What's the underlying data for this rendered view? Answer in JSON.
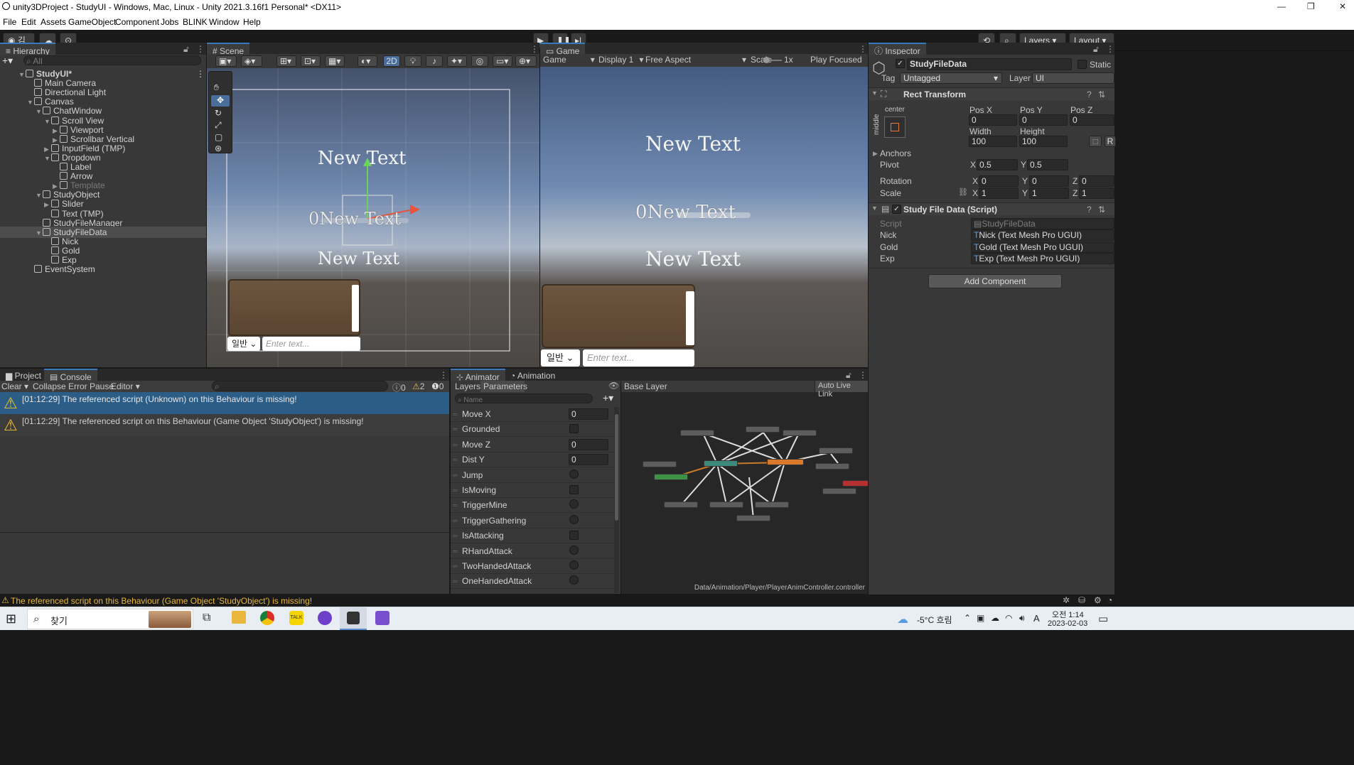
{
  "window": {
    "title": "unity3DProject - StudyUI - Windows, Mac, Linux - Unity 2021.3.16f1 Personal* <DX11>"
  },
  "menu": [
    "File",
    "Edit",
    "Assets",
    "GameObject",
    "Component",
    "Jobs",
    "BLINK",
    "Window",
    "Help"
  ],
  "toolbar": {
    "account": "김",
    "layers": "Layers",
    "layout": "Layout"
  },
  "hierarchy": {
    "tab": "Hierarchy",
    "search_placeholder": "All",
    "items": [
      {
        "label": "StudyUI*",
        "depth": 0,
        "arrow": "▼",
        "scene": true
      },
      {
        "label": "Main Camera",
        "depth": 1,
        "arrow": ""
      },
      {
        "label": "Directional Light",
        "depth": 1,
        "arrow": ""
      },
      {
        "label": "Canvas",
        "depth": 1,
        "arrow": "▼"
      },
      {
        "label": "ChatWindow",
        "depth": 2,
        "arrow": "▼"
      },
      {
        "label": "Scroll View",
        "depth": 3,
        "arrow": "▼"
      },
      {
        "label": "Viewport",
        "depth": 4,
        "arrow": "▶"
      },
      {
        "label": "Scrollbar Vertical",
        "depth": 4,
        "arrow": "▶"
      },
      {
        "label": "InputField (TMP)",
        "depth": 3,
        "arrow": "▶"
      },
      {
        "label": "Dropdown",
        "depth": 3,
        "arrow": "▼"
      },
      {
        "label": "Label",
        "depth": 4,
        "arrow": ""
      },
      {
        "label": "Arrow",
        "depth": 4,
        "arrow": ""
      },
      {
        "label": "Template",
        "depth": 4,
        "arrow": "▶",
        "dim": true
      },
      {
        "label": "StudyObject",
        "depth": 2,
        "arrow": "▼"
      },
      {
        "label": "Slider",
        "depth": 3,
        "arrow": "▶"
      },
      {
        "label": "Text (TMP)",
        "depth": 3,
        "arrow": ""
      },
      {
        "label": "StudyFileManager",
        "depth": 2,
        "arrow": ""
      },
      {
        "label": "StudyFileData",
        "depth": 2,
        "arrow": "▼",
        "selected": true
      },
      {
        "label": "Nick",
        "depth": 3,
        "arrow": ""
      },
      {
        "label": "Gold",
        "depth": 3,
        "arrow": ""
      },
      {
        "label": "Exp",
        "depth": 3,
        "arrow": ""
      },
      {
        "label": "EventSystem",
        "depth": 1,
        "arrow": ""
      }
    ]
  },
  "scene": {
    "tab": "Scene",
    "mode_2d": "2D",
    "texts": [
      "New Text",
      "0New Text",
      "New Text"
    ],
    "dropdown_value": "일반",
    "input_placeholder": "Enter text..."
  },
  "game": {
    "tab": "Game",
    "mode": "Game",
    "display": "Display 1",
    "aspect": "Free Aspect",
    "scale_label": "Scale",
    "scale_value": "1x",
    "play_focused": "Play Focused",
    "texts": [
      "New Text",
      "0New Text",
      "New Text"
    ],
    "dropdown_value": "일반",
    "input_placeholder": "Enter text..."
  },
  "inspector": {
    "tab": "Inspector",
    "object_name": "StudyFileData",
    "static_label": "Static",
    "tag_label": "Tag",
    "tag_value": "Untagged",
    "layer_label": "Layer",
    "layer_value": "UI",
    "rect_transform": {
      "title": "Rect Transform",
      "anchor_h": "center",
      "anchor_v": "middle",
      "pos_x_label": "Pos X",
      "pos_x": "0",
      "pos_y_label": "Pos Y",
      "pos_y": "0",
      "pos_z_label": "Pos Z",
      "pos_z": "0",
      "width_label": "Width",
      "width": "100",
      "height_label": "Height",
      "height": "100",
      "r_button": "R",
      "anchors_label": "Anchors",
      "pivot_label": "Pivot",
      "pivot_x": "0.5",
      "pivot_y": "0.5",
      "rotation_label": "Rotation",
      "rot_x": "0",
      "rot_y": "0",
      "rot_z": "0",
      "scale_label": "Scale",
      "scale_x": "1",
      "scale_y": "1",
      "scale_z": "1",
      "x": "X",
      "y": "Y",
      "z": "Z"
    },
    "script_component": {
      "title": "Study File Data (Script)",
      "script_label": "Script",
      "script_value": "StudyFileData",
      "nick_label": "Nick",
      "nick_value": "Nick (Text Mesh Pro UGUI)",
      "gold_label": "Gold",
      "gold_value": "Gold (Text Mesh Pro UGUI)",
      "exp_label": "Exp",
      "exp_value": "Exp (Text Mesh Pro UGUI)"
    },
    "add_component": "Add Component"
  },
  "console": {
    "project_tab": "Project",
    "console_tab": "Console",
    "clear": "Clear",
    "collapse": "Collapse",
    "error_pause": "Error Pause",
    "editor": "Editor",
    "info_count": "0",
    "warn_count": "2",
    "error_count": "0",
    "messages": [
      "[01:12:29] The referenced script (Unknown) on this Behaviour is missing!",
      "[01:12:29] The referenced script on this Behaviour (Game Object 'StudyObject') is missing!"
    ]
  },
  "animator": {
    "animator_tab": "Animator",
    "animation_tab": "Animation",
    "layers_tab": "Layers",
    "parameters_tab": "Parameters",
    "search_placeholder": "Name",
    "base_layer": "Base Layer",
    "auto_live_link": "Auto Live Link",
    "path": "Data/Animation/Player/PlayerAnimController.controller",
    "params": [
      {
        "name": "Move X",
        "type": "float",
        "value": "0"
      },
      {
        "name": "Grounded",
        "type": "bool"
      },
      {
        "name": "Move Z",
        "type": "float",
        "value": "0"
      },
      {
        "name": "Dist Y",
        "type": "float",
        "value": "0"
      },
      {
        "name": "Jump",
        "type": "trigger"
      },
      {
        "name": "IsMoving",
        "type": "bool"
      },
      {
        "name": "TriggerMine",
        "type": "trigger"
      },
      {
        "name": "TriggerGathering",
        "type": "trigger"
      },
      {
        "name": "IsAttacking",
        "type": "bool"
      },
      {
        "name": "RHandAttack",
        "type": "trigger"
      },
      {
        "name": "TwoHandedAttack",
        "type": "trigger"
      },
      {
        "name": "OneHandedAttack",
        "type": "trigger"
      }
    ]
  },
  "statusbar": {
    "message": "The referenced script on this Behaviour (Game Object 'StudyObject') is missing!"
  },
  "taskbar": {
    "search": "찾기",
    "weather": "-5°C 흐림",
    "ime": "A",
    "time": "오전 1:14",
    "date": "2023-02-03"
  }
}
